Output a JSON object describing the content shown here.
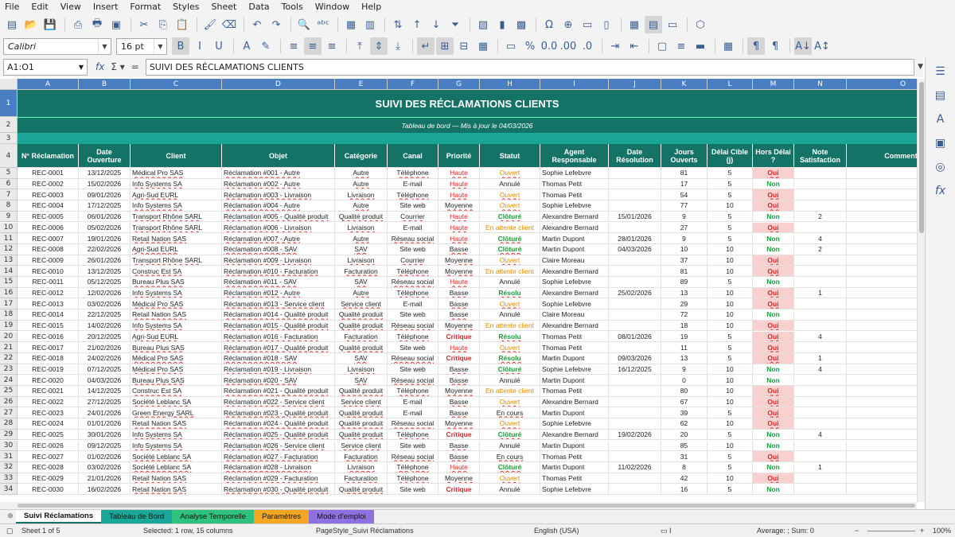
{
  "menu": [
    "File",
    "Edit",
    "View",
    "Insert",
    "Format",
    "Styles",
    "Sheet",
    "Data",
    "Tools",
    "Window",
    "Help"
  ],
  "font": {
    "name": "Calibri",
    "size": "16 pt"
  },
  "namebox": "A1:O1",
  "formula": "SUIVI DES RÉCLAMATIONS CLIENTS",
  "colors": {
    "header_bg": "#147266",
    "band_bg": "#1aa79a",
    "accent": "#4a7ec3",
    "oui_bg": "#f8d0d0"
  },
  "columns": [
    "A",
    "B",
    "C",
    "D",
    "E",
    "F",
    "G",
    "H",
    "I",
    "J",
    "K",
    "L",
    "M",
    "N",
    "O"
  ],
  "title": "SUIVI DES RÉCLAMATIONS CLIENTS",
  "subtitle": "Tableau de bord — Mis à jour le 04/03/2026",
  "headers": [
    "N° Réclamation",
    "Date Ouverture",
    "Client",
    "Objet",
    "Catégorie",
    "Canal",
    "Priorité",
    "Statut",
    "Agent Responsable",
    "Date Résolution",
    "Jours Ouverts",
    "Délai Cible (j)",
    "Hors Délai ?",
    "Note Satisfaction",
    "Commenta"
  ],
  "rows": [
    [
      "REC-0001",
      "13/12/2025",
      "Médical Pro SAS",
      "Réclamation #001 - Autre",
      "Autre",
      "Téléphone",
      "Haute",
      "Ouvert",
      "Sophie Lefebvre",
      "",
      "81",
      "5",
      "Oui",
      ""
    ],
    [
      "REC-0002",
      "15/02/2026",
      "Info Systems SA",
      "Réclamation #002 - Autre",
      "Autre",
      "E-mail",
      "Haute",
      "Annulé",
      "Thomas Petit",
      "",
      "17",
      "5",
      "Non",
      ""
    ],
    [
      "REC-0003",
      "09/01/2026",
      "Agri-Sud EURL",
      "Réclamation #003 - Livraison",
      "Livraison",
      "Téléphone",
      "Haute",
      "Ouvert",
      "Thomas Petit",
      "",
      "54",
      "5",
      "Oui",
      ""
    ],
    [
      "REC-0004",
      "17/12/2025",
      "Info Systems SA",
      "Réclamation #004 - Autre",
      "Autre",
      "Site web",
      "Moyenne",
      "Ouvert",
      "Sophie Lefebvre",
      "",
      "77",
      "10",
      "Oui",
      ""
    ],
    [
      "REC-0005",
      "06/01/2026",
      "Transport Rhône SARL",
      "Réclamation #005 - Qualité produit",
      "Qualité produit",
      "Courrier",
      "Haute",
      "Clôturé",
      "Alexandre Bernard",
      "15/01/2026",
      "9",
      "5",
      "Non",
      "2"
    ],
    [
      "REC-0006",
      "05/02/2026",
      "Transport Rhône SARL",
      "Réclamation #006 - Livraison",
      "Livraison",
      "E-mail",
      "Haute",
      "En attente client",
      "Alexandre Bernard",
      "",
      "27",
      "5",
      "Oui",
      ""
    ],
    [
      "REC-0007",
      "19/01/2026",
      "Retail Nation SAS",
      "Réclamation #007 - Autre",
      "Autre",
      "Réseau social",
      "Haute",
      "Clôturé",
      "Martin Dupont",
      "28/01/2026",
      "9",
      "5",
      "Non",
      "4"
    ],
    [
      "REC-0008",
      "22/02/2026",
      "Agri-Sud EURL",
      "Réclamation #008 - SAV",
      "SAV",
      "Site web",
      "Basse",
      "Clôturé",
      "Martin Dupont",
      "04/03/2026",
      "10",
      "10",
      "Non",
      "2"
    ],
    [
      "REC-0009",
      "26/01/2026",
      "Transport Rhône SARL",
      "Réclamation #009 - Livraison",
      "Livraison",
      "Courrier",
      "Moyenne",
      "Ouvert",
      "Claire Moreau",
      "",
      "37",
      "10",
      "Oui",
      ""
    ],
    [
      "REC-0010",
      "13/12/2025",
      "Construc Est SA",
      "Réclamation #010 - Facturation",
      "Facturation",
      "Téléphone",
      "Moyenne",
      "En attente client",
      "Alexandre Bernard",
      "",
      "81",
      "10",
      "Oui",
      ""
    ],
    [
      "REC-0011",
      "05/12/2025",
      "Bureau Plus SAS",
      "Réclamation #011 - SAV",
      "SAV",
      "Réseau social",
      "Haute",
      "Annulé",
      "Sophie Lefebvre",
      "",
      "89",
      "5",
      "Non",
      ""
    ],
    [
      "REC-0012",
      "12/02/2026",
      "Info Systems SA",
      "Réclamation #012 - Autre",
      "Autre",
      "Téléphone",
      "Basse",
      "Résolu",
      "Alexandre Bernard",
      "25/02/2026",
      "13",
      "10",
      "Oui",
      "1"
    ],
    [
      "REC-0013",
      "03/02/2026",
      "Médical Pro SAS",
      "Réclamation #013 - Service client",
      "Service client",
      "E-mail",
      "Basse",
      "Ouvert",
      "Sophie Lefebvre",
      "",
      "29",
      "10",
      "Oui",
      ""
    ],
    [
      "REC-0014",
      "22/12/2025",
      "Retail Nation SAS",
      "Réclamation #014 - Qualité produit",
      "Qualité produit",
      "Site web",
      "Basse",
      "Annulé",
      "Claire Moreau",
      "",
      "72",
      "10",
      "Non",
      ""
    ],
    [
      "REC-0015",
      "14/02/2026",
      "Info Systems SA",
      "Réclamation #015 - Qualité produit",
      "Qualité produit",
      "Réseau social",
      "Moyenne",
      "En attente client",
      "Alexandre Bernard",
      "",
      "18",
      "10",
      "Oui",
      ""
    ],
    [
      "REC-0016",
      "20/12/2025",
      "Agri-Sud EURL",
      "Réclamation #016 - Facturation",
      "Facturation",
      "Téléphone",
      "Critique",
      "Résolu",
      "Thomas Petit",
      "08/01/2026",
      "19",
      "5",
      "Oui",
      "4"
    ],
    [
      "REC-0017",
      "21/02/2026",
      "Bureau Plus SAS",
      "Réclamation #017 - Qualité produit",
      "Qualité produit",
      "Site web",
      "Haute",
      "Ouvert",
      "Thomas Petit",
      "",
      "11",
      "5",
      "Oui",
      ""
    ],
    [
      "REC-0018",
      "24/02/2026",
      "Médical Pro SAS",
      "Réclamation #018 - SAV",
      "SAV",
      "Réseau social",
      "Critique",
      "Résolu",
      "Martin Dupont",
      "09/03/2026",
      "13",
      "5",
      "Oui",
      "1"
    ],
    [
      "REC-0019",
      "07/12/2025",
      "Médical Pro SAS",
      "Réclamation #019 - Livraison",
      "Livraison",
      "Site web",
      "Basse",
      "Clôturé",
      "Sophie Lefebvre",
      "16/12/2025",
      "9",
      "10",
      "Non",
      "4"
    ],
    [
      "REC-0020",
      "04/03/2026",
      "Bureau Plus SAS",
      "Réclamation #020 - SAV",
      "SAV",
      "Réseau social",
      "Basse",
      "Annulé",
      "Martin Dupont",
      "",
      "0",
      "10",
      "Non",
      ""
    ],
    [
      "REC-0021",
      "14/12/2025",
      "Construc Est SA",
      "Réclamation #021 - Qualité produit",
      "Qualité produit",
      "Téléphone",
      "Moyenne",
      "En attente client",
      "Thomas Petit",
      "",
      "80",
      "10",
      "Oui",
      ""
    ],
    [
      "REC-0022",
      "27/12/2025",
      "Société Leblanc SA",
      "Réclamation #022 - Service client",
      "Service client",
      "E-mail",
      "Basse",
      "Ouvert",
      "Alexandre Bernard",
      "",
      "67",
      "10",
      "Oui",
      ""
    ],
    [
      "REC-0023",
      "24/01/2026",
      "Green Energy SARL",
      "Réclamation #023 - Qualité produit",
      "Qualité produit",
      "E-mail",
      "Basse",
      "En cours",
      "Martin Dupont",
      "",
      "39",
      "5",
      "Oui",
      ""
    ],
    [
      "REC-0024",
      "01/01/2026",
      "Retail Nation SAS",
      "Réclamation #024 - Qualité produit",
      "Qualité produit",
      "Réseau social",
      "Moyenne",
      "Ouvert",
      "Sophie Lefebvre",
      "",
      "62",
      "10",
      "Oui",
      ""
    ],
    [
      "REC-0025",
      "30/01/2026",
      "Info Systems SA",
      "Réclamation #025 - Qualité produit",
      "Qualité produit",
      "Téléphone",
      "Critique",
      "Clôturé",
      "Alexandre Bernard",
      "19/02/2026",
      "20",
      "5",
      "Non",
      "4"
    ],
    [
      "REC-0026",
      "09/12/2025",
      "Info Systems SA",
      "Réclamation #026 - Service client",
      "Service client",
      "Site web",
      "Basse",
      "Annulé",
      "Martin Dupont",
      "",
      "85",
      "10",
      "Non",
      ""
    ],
    [
      "REC-0027",
      "01/02/2026",
      "Société Leblanc SA",
      "Réclamation #027 - Facturation",
      "Facturation",
      "Réseau social",
      "Basse",
      "En cours",
      "Thomas Petit",
      "",
      "31",
      "5",
      "Oui",
      ""
    ],
    [
      "REC-0028",
      "03/02/2026",
      "Société Leblanc SA",
      "Réclamation #028 - Livraison",
      "Livraison",
      "Téléphone",
      "Haute",
      "Clôturé",
      "Martin Dupont",
      "11/02/2026",
      "8",
      "5",
      "Non",
      "1"
    ],
    [
      "REC-0029",
      "21/01/2026",
      "Retail Nation SAS",
      "Réclamation #029 - Facturation",
      "Facturation",
      "Téléphone",
      "Moyenne",
      "Ouvert",
      "Thomas Petit",
      "",
      "42",
      "10",
      "Oui",
      ""
    ],
    [
      "REC-0030",
      "16/02/2026",
      "Retail Nation SAS",
      "Réclamation #030 - Qualité produit",
      "Qualité produit",
      "Site web",
      "Critique",
      "Annulé",
      "Sophie Lefebvre",
      "",
      "16",
      "5",
      "Non",
      ""
    ]
  ],
  "tabs": [
    {
      "label": "Suivi Réclamations",
      "color": "#ffffff"
    },
    {
      "label": "Tableau de Bord",
      "color": "#1aa79a"
    },
    {
      "label": "Analyse Temporelle",
      "color": "#2ec27e"
    },
    {
      "label": "Paramètres",
      "color": "#f5a623"
    },
    {
      "label": "Mode d'emploi",
      "color": "#8f70e0"
    }
  ],
  "status": {
    "sheet": "Sheet 1 of 5",
    "selection": "Selected: 1 row, 15 columns",
    "pagestyle": "PageStyle_Suivi Réclamations",
    "language": "English (USA)",
    "sum": "Average: ; Sum: 0",
    "zoom": "100%"
  }
}
